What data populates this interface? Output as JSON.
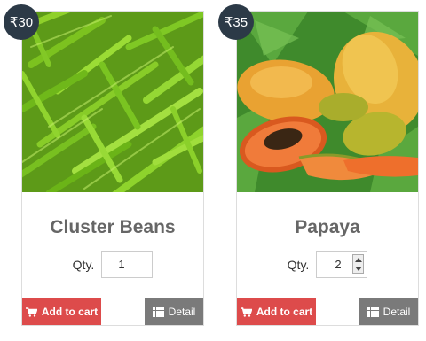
{
  "products": [
    {
      "price": "₹30",
      "name": "Cluster Beans",
      "qty_label": "Qty.",
      "qty_value": "1",
      "cart_label": "Add to cart",
      "detail_label": "Detail",
      "image": "green-beans-photo"
    },
    {
      "price": "₹35",
      "name": "Papaya",
      "qty_label": "Qty.",
      "qty_value": "2",
      "cart_label": "Add to cart",
      "detail_label": "Detail",
      "image": "papaya-photo"
    }
  ],
  "colors": {
    "badge": "#2c3a47",
    "cart_button": "#dd4b4b",
    "detail_button": "#7a7a7a",
    "product_name": "#666666"
  },
  "icons": {
    "cart": "cart-icon",
    "detail": "list-icon"
  }
}
